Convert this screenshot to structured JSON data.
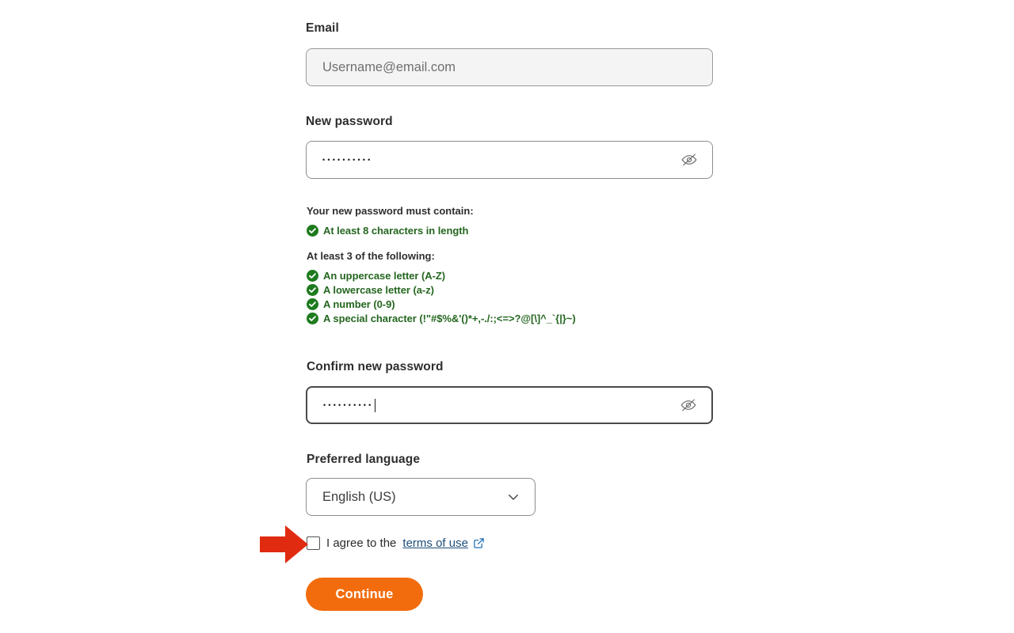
{
  "form": {
    "email": {
      "label": "Email",
      "placeholder": "Username@email.com",
      "value": ""
    },
    "new_password": {
      "label": "New password",
      "value": "••••••••••",
      "toggle_icon": "eye-off-icon"
    },
    "confirm_password": {
      "label": "Confirm new password",
      "value": "••••••••••",
      "toggle_icon": "eye-off-icon",
      "focused": true
    },
    "password_rules": {
      "heading": "Your new password must contain:",
      "primary": [
        {
          "text": "At least 8 characters in length",
          "met": true
        }
      ],
      "subheading": "At least 3 of the following:",
      "secondary": [
        {
          "text": "An uppercase letter (A-Z)",
          "met": true
        },
        {
          "text": "A lowercase letter (a-z)",
          "met": true
        },
        {
          "text": "A number (0-9)",
          "met": true
        },
        {
          "text": "A special character (!\"#$%&'()*+,-./:;<=>?@[\\]^_`{|}~)",
          "met": true
        }
      ]
    },
    "language": {
      "label": "Preferred language",
      "selected": "English (US)",
      "chevron_icon": "chevron-down-icon"
    },
    "agreement": {
      "checked": false,
      "text_before": "I agree to the",
      "link_text": "terms of use",
      "external_icon": "external-link-icon"
    },
    "submit": {
      "label": "Continue"
    }
  },
  "annotation": {
    "arrow_icon": "right-arrow-annotation",
    "points_at": "agreement-checkbox"
  },
  "colors": {
    "accent_orange": "#f26c0d",
    "success_green": "#24661f",
    "link_blue": "#1f4f7a",
    "annotation_red": "#e02b11",
    "border_grey": "#8d8d8d",
    "disabled_bg": "#f4f4f4"
  }
}
